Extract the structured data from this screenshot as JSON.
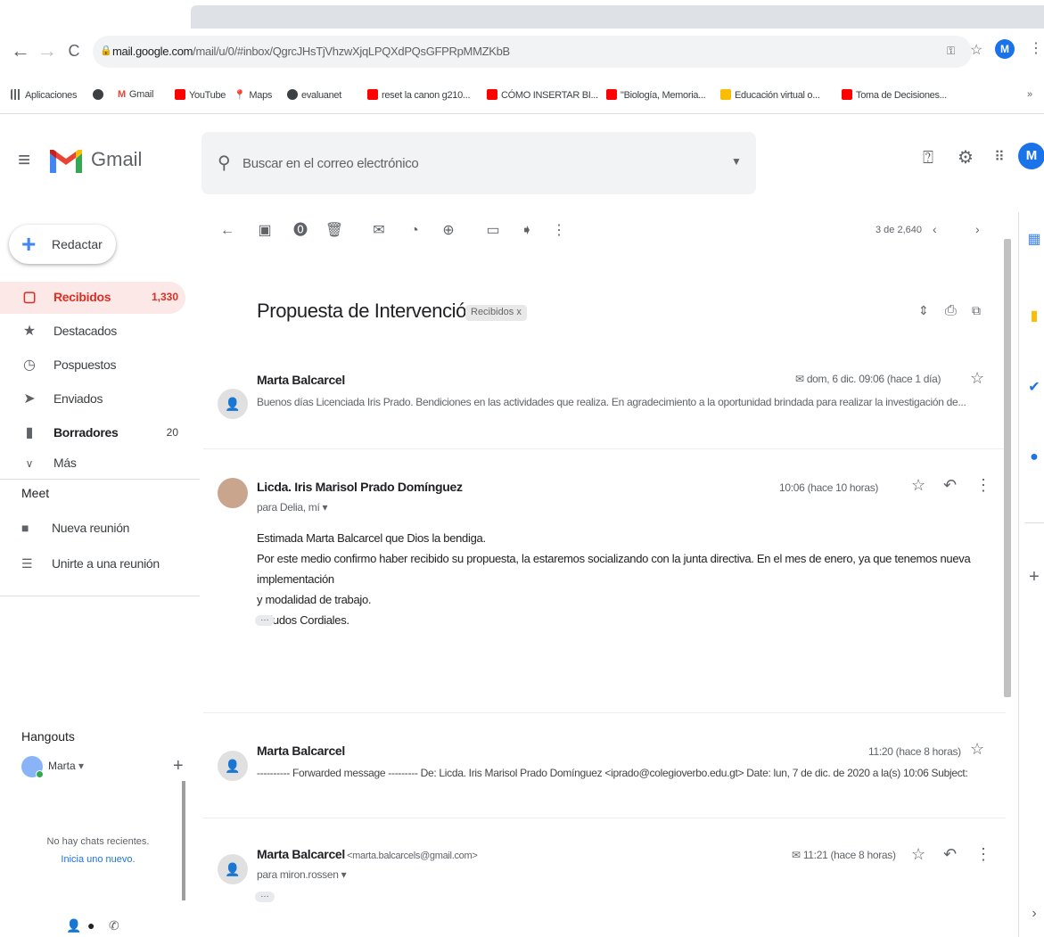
{
  "browser": {
    "url_host": "mail.google.com",
    "url_path": "/mail/u/0/#inbox/QgrcJHsTjVhzwXjqLPQXdPQsGFPRpMMZKbB",
    "profile_initial": "M",
    "bookmarks": [
      {
        "label": "Aplicaciones",
        "color": "#5f6368"
      },
      {
        "label": "",
        "color": "#3c4043"
      },
      {
        "label": "Gmail",
        "color": "#ea4335"
      },
      {
        "label": "YouTube",
        "color": "#ff0000"
      },
      {
        "label": "Maps",
        "color": "#34a853"
      },
      {
        "label": "evaluanet",
        "color": "#3c4043"
      },
      {
        "label": "reset la canon g210...",
        "color": "#ff0000"
      },
      {
        "label": "CÓMO INSERTAR BI...",
        "color": "#ff0000"
      },
      {
        "label": "\"Biología, Memoria...",
        "color": "#ff0000"
      },
      {
        "label": "Educación virtual o...",
        "color": "#fbbc04"
      },
      {
        "label": "Toma de Decisiones...",
        "color": "#ff0000"
      }
    ],
    "bookmarks_more": "»"
  },
  "gmail": {
    "brand": "Gmail",
    "search_placeholder": "Buscar en el correo electrónico",
    "avatar_initial": "M"
  },
  "sidebar": {
    "compose_label": "Redactar",
    "items": [
      {
        "label": "Recibidos",
        "count": "1,330",
        "icon": "inbox-icon"
      },
      {
        "label": "Destacados",
        "count": "",
        "icon": "star-icon"
      },
      {
        "label": "Pospuestos",
        "count": "",
        "icon": "clock-icon"
      },
      {
        "label": "Enviados",
        "count": "",
        "icon": "send-icon"
      },
      {
        "label": "Borradores",
        "count": "20",
        "icon": "draft-icon"
      },
      {
        "label": "Más",
        "count": "",
        "icon": "chevron-down-icon"
      }
    ],
    "meet_title": "Meet",
    "meet_new": "Nueva reunión",
    "meet_join": "Unirte a una reunión",
    "hangouts_title": "Hangouts",
    "hangouts_user": "Marta",
    "no_chats": "No hay chats recientes.",
    "start_new": "Inicia uno nuevo."
  },
  "toolbar": {
    "pagination": "3 de 2,640"
  },
  "thread": {
    "subject": "Propuesta de Intervención",
    "label": "Recibidos x",
    "messages": [
      {
        "sender": "Marta Balcarcel",
        "email": "",
        "time": "dom, 6 dic. 09:06 (hace 1 día)",
        "snippet": "Buenos días Licenciada Iris Prado. Bendiciones en las actividades que realiza. En agradecimiento a la oportunidad brindada para realizar la investigación de..."
      },
      {
        "sender": "Licda. Iris Marisol Prado Domínguez",
        "time": "10:06 (hace 10 horas)",
        "to": "para Delia, mí",
        "body": [
          "Estimada Marta Balcarcel que Dios la bendiga.",
          "Por este medio confirmo  haber recibido su propuesta, la estaremos socializando con la junta directiva. En el mes de enero, ya que tenemos nueva implementación",
          "y modalidad de trabajo.",
          "Saludos Cordiales."
        ]
      },
      {
        "sender": "Marta Balcarcel",
        "time": "11:20 (hace 8 horas)",
        "snippet": "---------- Forwarded message --------- De: Licda. Iris Marisol Prado Domínguez <iprado@colegioverbo.edu.gt> Date: lun, 7 de dic. de 2020 a la(s) 10:06 Subject:"
      },
      {
        "sender": "Marta Balcarcel",
        "email": "<marta.balcarcels@gmail.com>",
        "time": "11:21 (hace 8 horas)",
        "to": "para miron.rossen"
      }
    ]
  }
}
